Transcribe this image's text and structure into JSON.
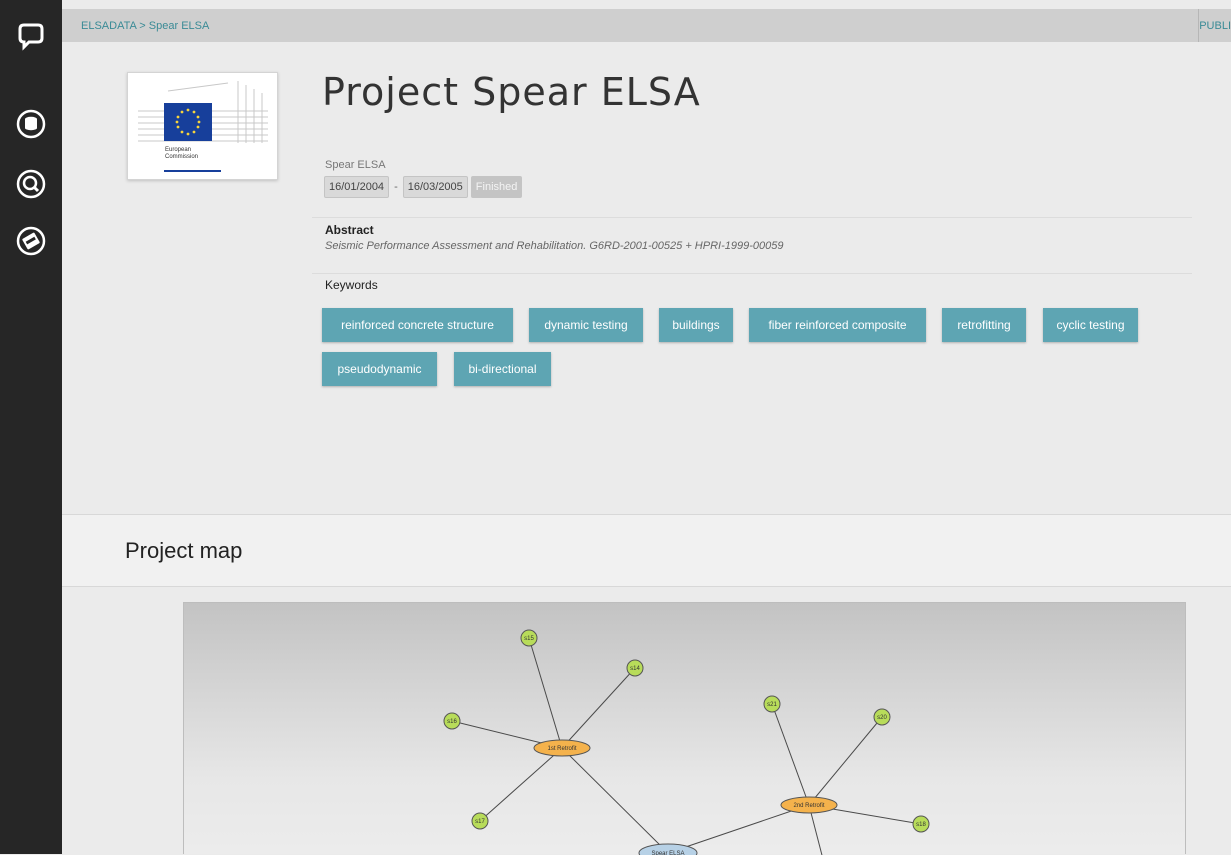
{
  "breadcrumb": {
    "root": "ELSADATA",
    "separator": ">",
    "current": "Spear ELSA"
  },
  "topbar": {
    "publish_label": "PUBLI"
  },
  "logo": {
    "line1": "European",
    "line2": "Commission"
  },
  "project": {
    "title": "Project Spear ELSA",
    "subtitle": "Spear ELSA",
    "start_date": "16/01/2004",
    "date_separator": "-",
    "end_date": "16/03/2005",
    "status": "Finished"
  },
  "abstract": {
    "label": "Abstract",
    "text": "Seismic Performance Assessment and Rehabilitation. G6RD-2001-00525 + HPRI-1999-00059"
  },
  "keywords": {
    "label": "Keywords",
    "items": [
      "reinforced concrete structure",
      "dynamic testing",
      "buildings",
      "fiber reinforced composite",
      "retrofitting",
      "cyclic testing",
      "pseudodynamic",
      "bi-directional"
    ]
  },
  "project_map": {
    "heading": "Project map",
    "nodes": [
      {
        "id": "root",
        "label": "Spear ELSA",
        "kind": "project"
      },
      {
        "id": "r1",
        "label": "1st Retrofit",
        "kind": "retrofit"
      },
      {
        "id": "r2",
        "label": "2nd Retrofit",
        "kind": "retrofit"
      },
      {
        "id": "s14",
        "label": "s14",
        "kind": "specimen"
      },
      {
        "id": "s15",
        "label": "s15",
        "kind": "specimen"
      },
      {
        "id": "s16",
        "label": "s16",
        "kind": "specimen"
      },
      {
        "id": "s17",
        "label": "s17",
        "kind": "specimen"
      },
      {
        "id": "s18",
        "label": "s18",
        "kind": "specimen"
      },
      {
        "id": "s20",
        "label": "s20",
        "kind": "specimen"
      },
      {
        "id": "s21",
        "label": "s21",
        "kind": "specimen"
      }
    ],
    "edges": [
      [
        "r1",
        "s15"
      ],
      [
        "r1",
        "s14"
      ],
      [
        "r1",
        "s16"
      ],
      [
        "r1",
        "s17"
      ],
      [
        "r1",
        "root"
      ],
      [
        "r2",
        "s21"
      ],
      [
        "r2",
        "s20"
      ],
      [
        "r2",
        "s18"
      ],
      [
        "r2",
        "root"
      ],
      [
        "r2",
        "off"
      ]
    ]
  },
  "colors": {
    "accent": "#5ea5b3",
    "link": "#3a8b96",
    "specimen_node": "#b8dc5a",
    "retrofit_node": "#f4b24c",
    "project_node": "#b7d1e6",
    "sidebar": "#262626"
  },
  "sidebar_icons": [
    "chat-bubble-icon",
    "database-icon",
    "search-icon",
    "manual-icon"
  ]
}
